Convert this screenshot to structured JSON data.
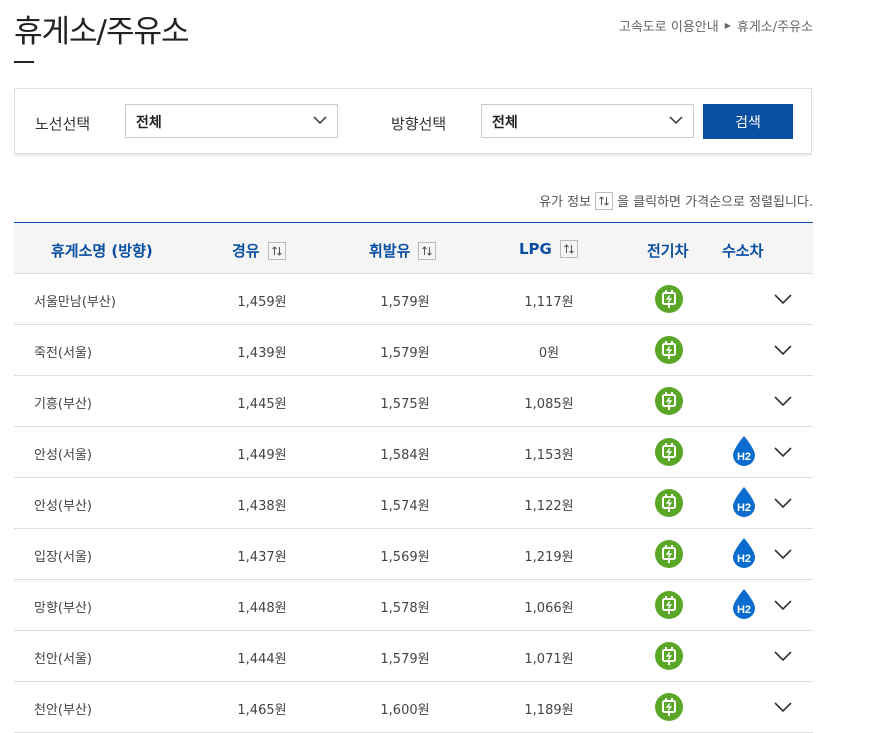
{
  "page": {
    "title": "휴게소/주유소",
    "breadcrumb": [
      "고속도로 이용안내",
      "휴게소/주유소"
    ]
  },
  "search": {
    "route_label": "노선선택",
    "route_value": "전체",
    "direction_label": "방향선택",
    "direction_value": "전체",
    "button_label": "검색"
  },
  "hint": {
    "before": "유가 정보",
    "after": "을 클릭하면 가격순으로 정렬됩니다."
  },
  "table": {
    "headers": {
      "name": "휴게소명 (방향)",
      "diesel": "경유",
      "gasoline": "휘발유",
      "lpg": "LPG",
      "ev": "전기차",
      "hydrogen": "수소차"
    },
    "rows": [
      {
        "name": "서울만남(부산)",
        "diesel": "1,459원",
        "gasoline": "1,579원",
        "lpg": "1,117원",
        "ev": true,
        "hydrogen": false
      },
      {
        "name": "죽전(서울)",
        "diesel": "1,439원",
        "gasoline": "1,579원",
        "lpg": "0원",
        "ev": true,
        "hydrogen": false
      },
      {
        "name": "기흥(부산)",
        "diesel": "1,445원",
        "gasoline": "1,575원",
        "lpg": "1,085원",
        "ev": true,
        "hydrogen": false
      },
      {
        "name": "안성(서울)",
        "diesel": "1,449원",
        "gasoline": "1,584원",
        "lpg": "1,153원",
        "ev": true,
        "hydrogen": true
      },
      {
        "name": "안성(부산)",
        "diesel": "1,438원",
        "gasoline": "1,574원",
        "lpg": "1,122원",
        "ev": true,
        "hydrogen": true
      },
      {
        "name": "입장(서울)",
        "diesel": "1,437원",
        "gasoline": "1,569원",
        "lpg": "1,219원",
        "ev": true,
        "hydrogen": true
      },
      {
        "name": "망향(부산)",
        "diesel": "1,448원",
        "gasoline": "1,578원",
        "lpg": "1,066원",
        "ev": true,
        "hydrogen": true
      },
      {
        "name": "천안(서울)",
        "diesel": "1,444원",
        "gasoline": "1,579원",
        "lpg": "1,071원",
        "ev": true,
        "hydrogen": false
      },
      {
        "name": "천안(부산)",
        "diesel": "1,465원",
        "gasoline": "1,600원",
        "lpg": "1,189원",
        "ev": true,
        "hydrogen": false
      }
    ]
  },
  "icons": {
    "ev": "ev-charger-icon",
    "hydrogen": "hydrogen-icon",
    "hydrogen_text": "H2",
    "sort": "sort-icon",
    "expand": "chevron-down-icon"
  },
  "colors": {
    "accent": "#0a4ea2",
    "ev_green": "#5aa627",
    "hydrogen_blue": "#0a6ccf"
  }
}
